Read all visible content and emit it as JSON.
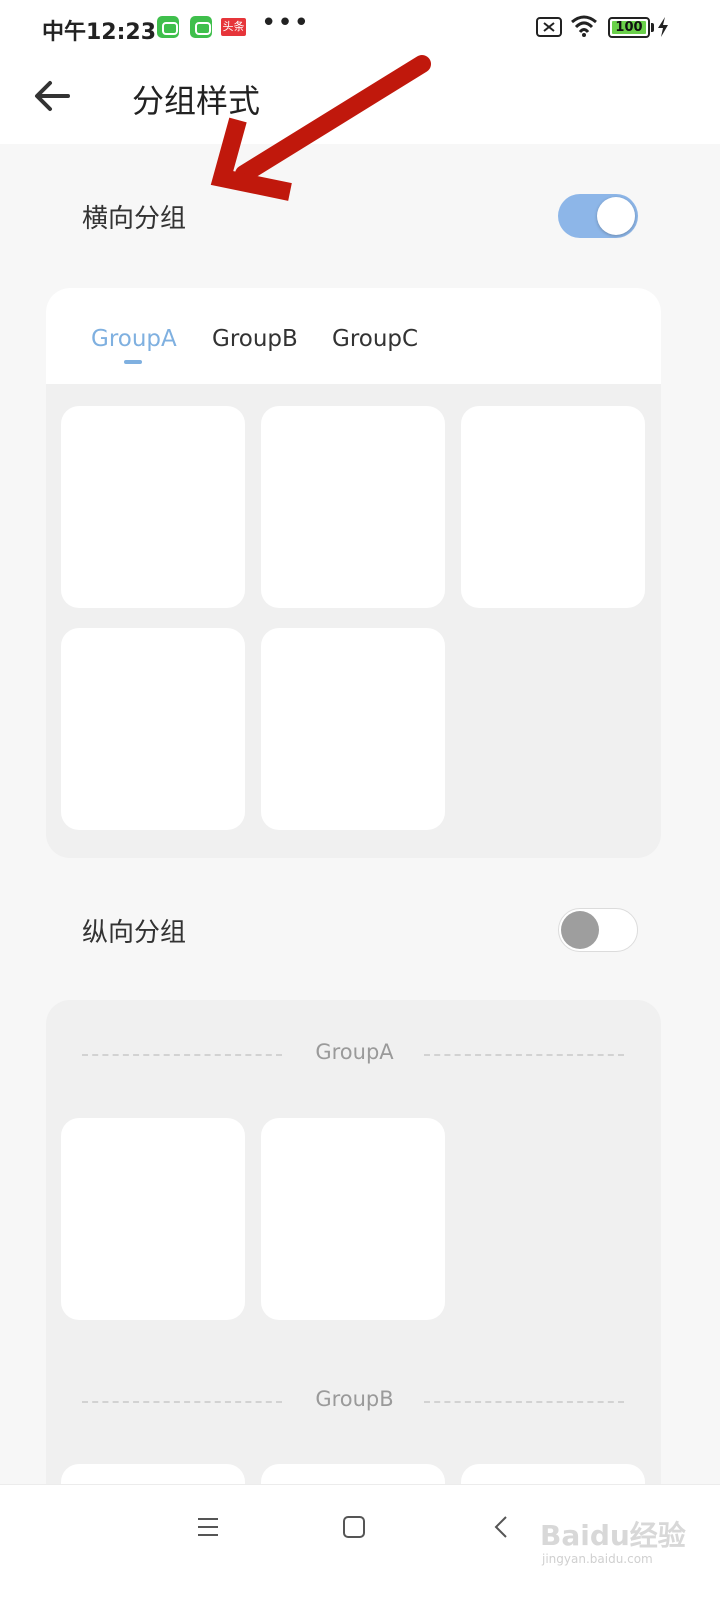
{
  "status_bar": {
    "time": "中午12:23",
    "news_badge": "头条",
    "more": "•••",
    "battery_level": "100"
  },
  "header": {
    "title": "分组样式"
  },
  "horizontal_group": {
    "label": "横向分组",
    "enabled": true,
    "tabs": [
      {
        "label": "GroupA",
        "active": true
      },
      {
        "label": "GroupB",
        "active": false
      },
      {
        "label": "GroupC",
        "active": false
      }
    ]
  },
  "vertical_group": {
    "label": "纵向分组",
    "enabled": false,
    "sections": [
      {
        "label": "GroupA"
      },
      {
        "label": "GroupB"
      }
    ]
  },
  "watermark": {
    "text": "Baidu经验",
    "sub": "jingyan.baidu.com"
  },
  "colors": {
    "accent": "#7fb0e0",
    "toggle_on": "#8db6e8",
    "arrow": "#c0180c"
  }
}
